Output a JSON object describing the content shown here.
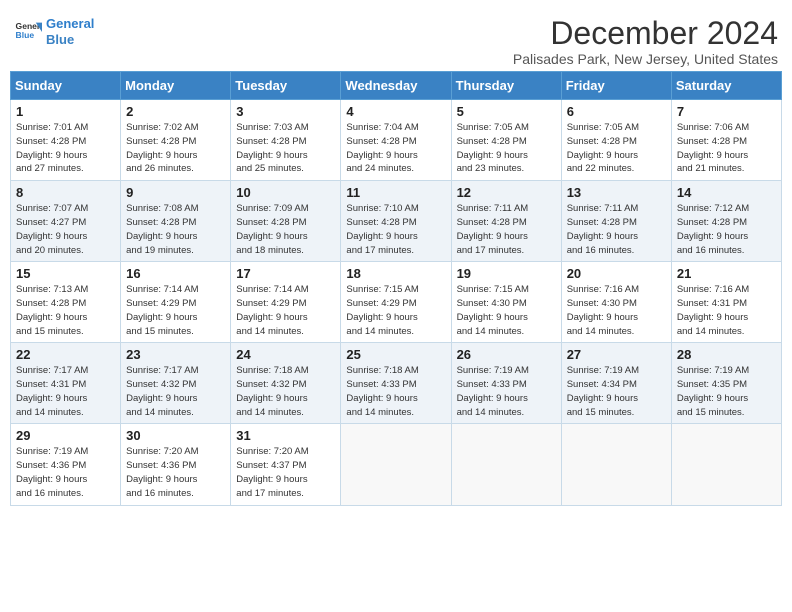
{
  "logo": {
    "line1": "General",
    "line2": "Blue"
  },
  "title": "December 2024",
  "subtitle": "Palisades Park, New Jersey, United States",
  "weekdays": [
    "Sunday",
    "Monday",
    "Tuesday",
    "Wednesday",
    "Thursday",
    "Friday",
    "Saturday"
  ],
  "weeks": [
    [
      {
        "day": "1",
        "info": "Sunrise: 7:01 AM\nSunset: 4:28 PM\nDaylight: 9 hours\nand 27 minutes."
      },
      {
        "day": "2",
        "info": "Sunrise: 7:02 AM\nSunset: 4:28 PM\nDaylight: 9 hours\nand 26 minutes."
      },
      {
        "day": "3",
        "info": "Sunrise: 7:03 AM\nSunset: 4:28 PM\nDaylight: 9 hours\nand 25 minutes."
      },
      {
        "day": "4",
        "info": "Sunrise: 7:04 AM\nSunset: 4:28 PM\nDaylight: 9 hours\nand 24 minutes."
      },
      {
        "day": "5",
        "info": "Sunrise: 7:05 AM\nSunset: 4:28 PM\nDaylight: 9 hours\nand 23 minutes."
      },
      {
        "day": "6",
        "info": "Sunrise: 7:05 AM\nSunset: 4:28 PM\nDaylight: 9 hours\nand 22 minutes."
      },
      {
        "day": "7",
        "info": "Sunrise: 7:06 AM\nSunset: 4:28 PM\nDaylight: 9 hours\nand 21 minutes."
      }
    ],
    [
      {
        "day": "8",
        "info": "Sunrise: 7:07 AM\nSunset: 4:27 PM\nDaylight: 9 hours\nand 20 minutes."
      },
      {
        "day": "9",
        "info": "Sunrise: 7:08 AM\nSunset: 4:28 PM\nDaylight: 9 hours\nand 19 minutes."
      },
      {
        "day": "10",
        "info": "Sunrise: 7:09 AM\nSunset: 4:28 PM\nDaylight: 9 hours\nand 18 minutes."
      },
      {
        "day": "11",
        "info": "Sunrise: 7:10 AM\nSunset: 4:28 PM\nDaylight: 9 hours\nand 17 minutes."
      },
      {
        "day": "12",
        "info": "Sunrise: 7:11 AM\nSunset: 4:28 PM\nDaylight: 9 hours\nand 17 minutes."
      },
      {
        "day": "13",
        "info": "Sunrise: 7:11 AM\nSunset: 4:28 PM\nDaylight: 9 hours\nand 16 minutes."
      },
      {
        "day": "14",
        "info": "Sunrise: 7:12 AM\nSunset: 4:28 PM\nDaylight: 9 hours\nand 16 minutes."
      }
    ],
    [
      {
        "day": "15",
        "info": "Sunrise: 7:13 AM\nSunset: 4:28 PM\nDaylight: 9 hours\nand 15 minutes."
      },
      {
        "day": "16",
        "info": "Sunrise: 7:14 AM\nSunset: 4:29 PM\nDaylight: 9 hours\nand 15 minutes."
      },
      {
        "day": "17",
        "info": "Sunrise: 7:14 AM\nSunset: 4:29 PM\nDaylight: 9 hours\nand 14 minutes."
      },
      {
        "day": "18",
        "info": "Sunrise: 7:15 AM\nSunset: 4:29 PM\nDaylight: 9 hours\nand 14 minutes."
      },
      {
        "day": "19",
        "info": "Sunrise: 7:15 AM\nSunset: 4:30 PM\nDaylight: 9 hours\nand 14 minutes."
      },
      {
        "day": "20",
        "info": "Sunrise: 7:16 AM\nSunset: 4:30 PM\nDaylight: 9 hours\nand 14 minutes."
      },
      {
        "day": "21",
        "info": "Sunrise: 7:16 AM\nSunset: 4:31 PM\nDaylight: 9 hours\nand 14 minutes."
      }
    ],
    [
      {
        "day": "22",
        "info": "Sunrise: 7:17 AM\nSunset: 4:31 PM\nDaylight: 9 hours\nand 14 minutes."
      },
      {
        "day": "23",
        "info": "Sunrise: 7:17 AM\nSunset: 4:32 PM\nDaylight: 9 hours\nand 14 minutes."
      },
      {
        "day": "24",
        "info": "Sunrise: 7:18 AM\nSunset: 4:32 PM\nDaylight: 9 hours\nand 14 minutes."
      },
      {
        "day": "25",
        "info": "Sunrise: 7:18 AM\nSunset: 4:33 PM\nDaylight: 9 hours\nand 14 minutes."
      },
      {
        "day": "26",
        "info": "Sunrise: 7:19 AM\nSunset: 4:33 PM\nDaylight: 9 hours\nand 14 minutes."
      },
      {
        "day": "27",
        "info": "Sunrise: 7:19 AM\nSunset: 4:34 PM\nDaylight: 9 hours\nand 15 minutes."
      },
      {
        "day": "28",
        "info": "Sunrise: 7:19 AM\nSunset: 4:35 PM\nDaylight: 9 hours\nand 15 minutes."
      }
    ],
    [
      {
        "day": "29",
        "info": "Sunrise: 7:19 AM\nSunset: 4:36 PM\nDaylight: 9 hours\nand 16 minutes."
      },
      {
        "day": "30",
        "info": "Sunrise: 7:20 AM\nSunset: 4:36 PM\nDaylight: 9 hours\nand 16 minutes."
      },
      {
        "day": "31",
        "info": "Sunrise: 7:20 AM\nSunset: 4:37 PM\nDaylight: 9 hours\nand 17 minutes."
      },
      {
        "day": "",
        "info": ""
      },
      {
        "day": "",
        "info": ""
      },
      {
        "day": "",
        "info": ""
      },
      {
        "day": "",
        "info": ""
      }
    ]
  ]
}
